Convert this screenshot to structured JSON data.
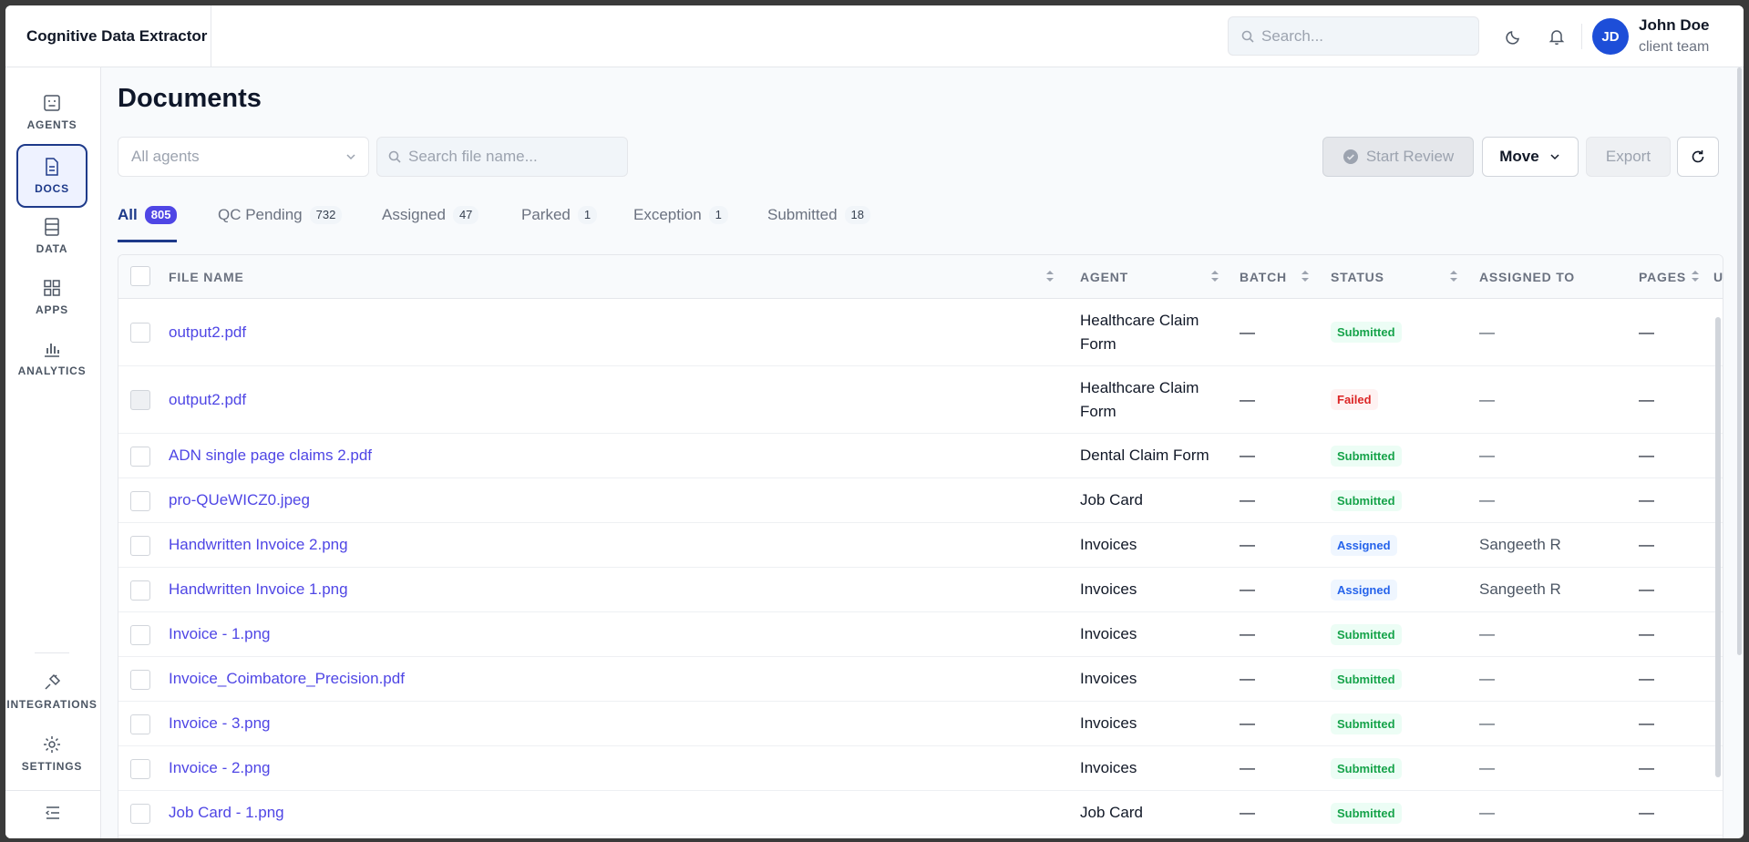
{
  "app": {
    "title": "Cognitive Data Extractor"
  },
  "header": {
    "search_placeholder": "Search...",
    "user": {
      "initials": "JD",
      "name": "John Doe",
      "team": "client team"
    }
  },
  "sidebar": {
    "items": [
      {
        "label": "AGENTS",
        "icon": "agent-icon"
      },
      {
        "label": "DOCS",
        "icon": "document-icon",
        "active": true
      },
      {
        "label": "DATA",
        "icon": "data-icon"
      },
      {
        "label": "APPS",
        "icon": "grid-icon"
      },
      {
        "label": "ANALYTICS",
        "icon": "bar-chart-icon"
      }
    ],
    "bottom": [
      {
        "label": "INTEGRATIONS",
        "icon": "plug-icon"
      },
      {
        "label": "SETTINGS",
        "icon": "gear-icon"
      }
    ]
  },
  "page": {
    "title": "Documents",
    "agent_filter": "All agents",
    "file_search_placeholder": "Search file name...",
    "buttons": {
      "review": "Start Review",
      "move": "Move",
      "export": "Export"
    }
  },
  "tabs": [
    {
      "label": "All",
      "count": "805",
      "active": true
    },
    {
      "label": "QC Pending",
      "count": "732"
    },
    {
      "label": "Assigned",
      "count": "47"
    },
    {
      "label": "Parked",
      "count": "1"
    },
    {
      "label": "Exception",
      "count": "1"
    },
    {
      "label": "Submitted",
      "count": "18"
    }
  ],
  "table": {
    "columns": {
      "file": "FILE NAME",
      "agent": "AGENT",
      "batch": "BATCH",
      "status": "STATUS",
      "assigned": "ASSIGNED TO",
      "pages": "PAGES",
      "extra": "U"
    },
    "rows": [
      {
        "file": "output2.pdf",
        "agent": "Healthcare Claim Form",
        "batch": "—",
        "status": "Submitted",
        "assigned": "—",
        "pages": "—"
      },
      {
        "file": "output2.pdf",
        "agent": "Healthcare Claim Form",
        "batch": "—",
        "status": "Failed",
        "assigned": "—",
        "pages": "—"
      },
      {
        "file": "ADN single page claims 2.pdf",
        "agent": "Dental Claim Form",
        "batch": "—",
        "status": "Submitted",
        "assigned": "—",
        "pages": "—"
      },
      {
        "file": "pro-QUeWICZ0.jpeg",
        "agent": "Job Card",
        "batch": "—",
        "status": "Submitted",
        "assigned": "—",
        "pages": "—"
      },
      {
        "file": "Handwritten Invoice 2.png",
        "agent": "Invoices",
        "batch": "—",
        "status": "Assigned",
        "assigned": "Sangeeth R",
        "pages": "—"
      },
      {
        "file": "Handwritten Invoice 1.png",
        "agent": "Invoices",
        "batch": "—",
        "status": "Assigned",
        "assigned": "Sangeeth R",
        "pages": "—"
      },
      {
        "file": "Invoice - 1.png",
        "agent": "Invoices",
        "batch": "—",
        "status": "Submitted",
        "assigned": "—",
        "pages": "—"
      },
      {
        "file": "Invoice_Coimbatore_Precision.pdf",
        "agent": "Invoices",
        "batch": "—",
        "status": "Submitted",
        "assigned": "—",
        "pages": "—"
      },
      {
        "file": "Invoice - 3.png",
        "agent": "Invoices",
        "batch": "—",
        "status": "Submitted",
        "assigned": "—",
        "pages": "—"
      },
      {
        "file": "Invoice - 2.png",
        "agent": "Invoices",
        "batch": "—",
        "status": "Submitted",
        "assigned": "—",
        "pages": "—"
      },
      {
        "file": "Job Card - 1.png",
        "agent": "Job Card",
        "batch": "—",
        "status": "Submitted",
        "assigned": "—",
        "pages": "—"
      }
    ]
  },
  "colors": {
    "accent": "#1e3a8a",
    "link": "#4f46e5",
    "submitted": "#16a34a",
    "failed": "#dc2626",
    "assigned": "#2563eb"
  }
}
